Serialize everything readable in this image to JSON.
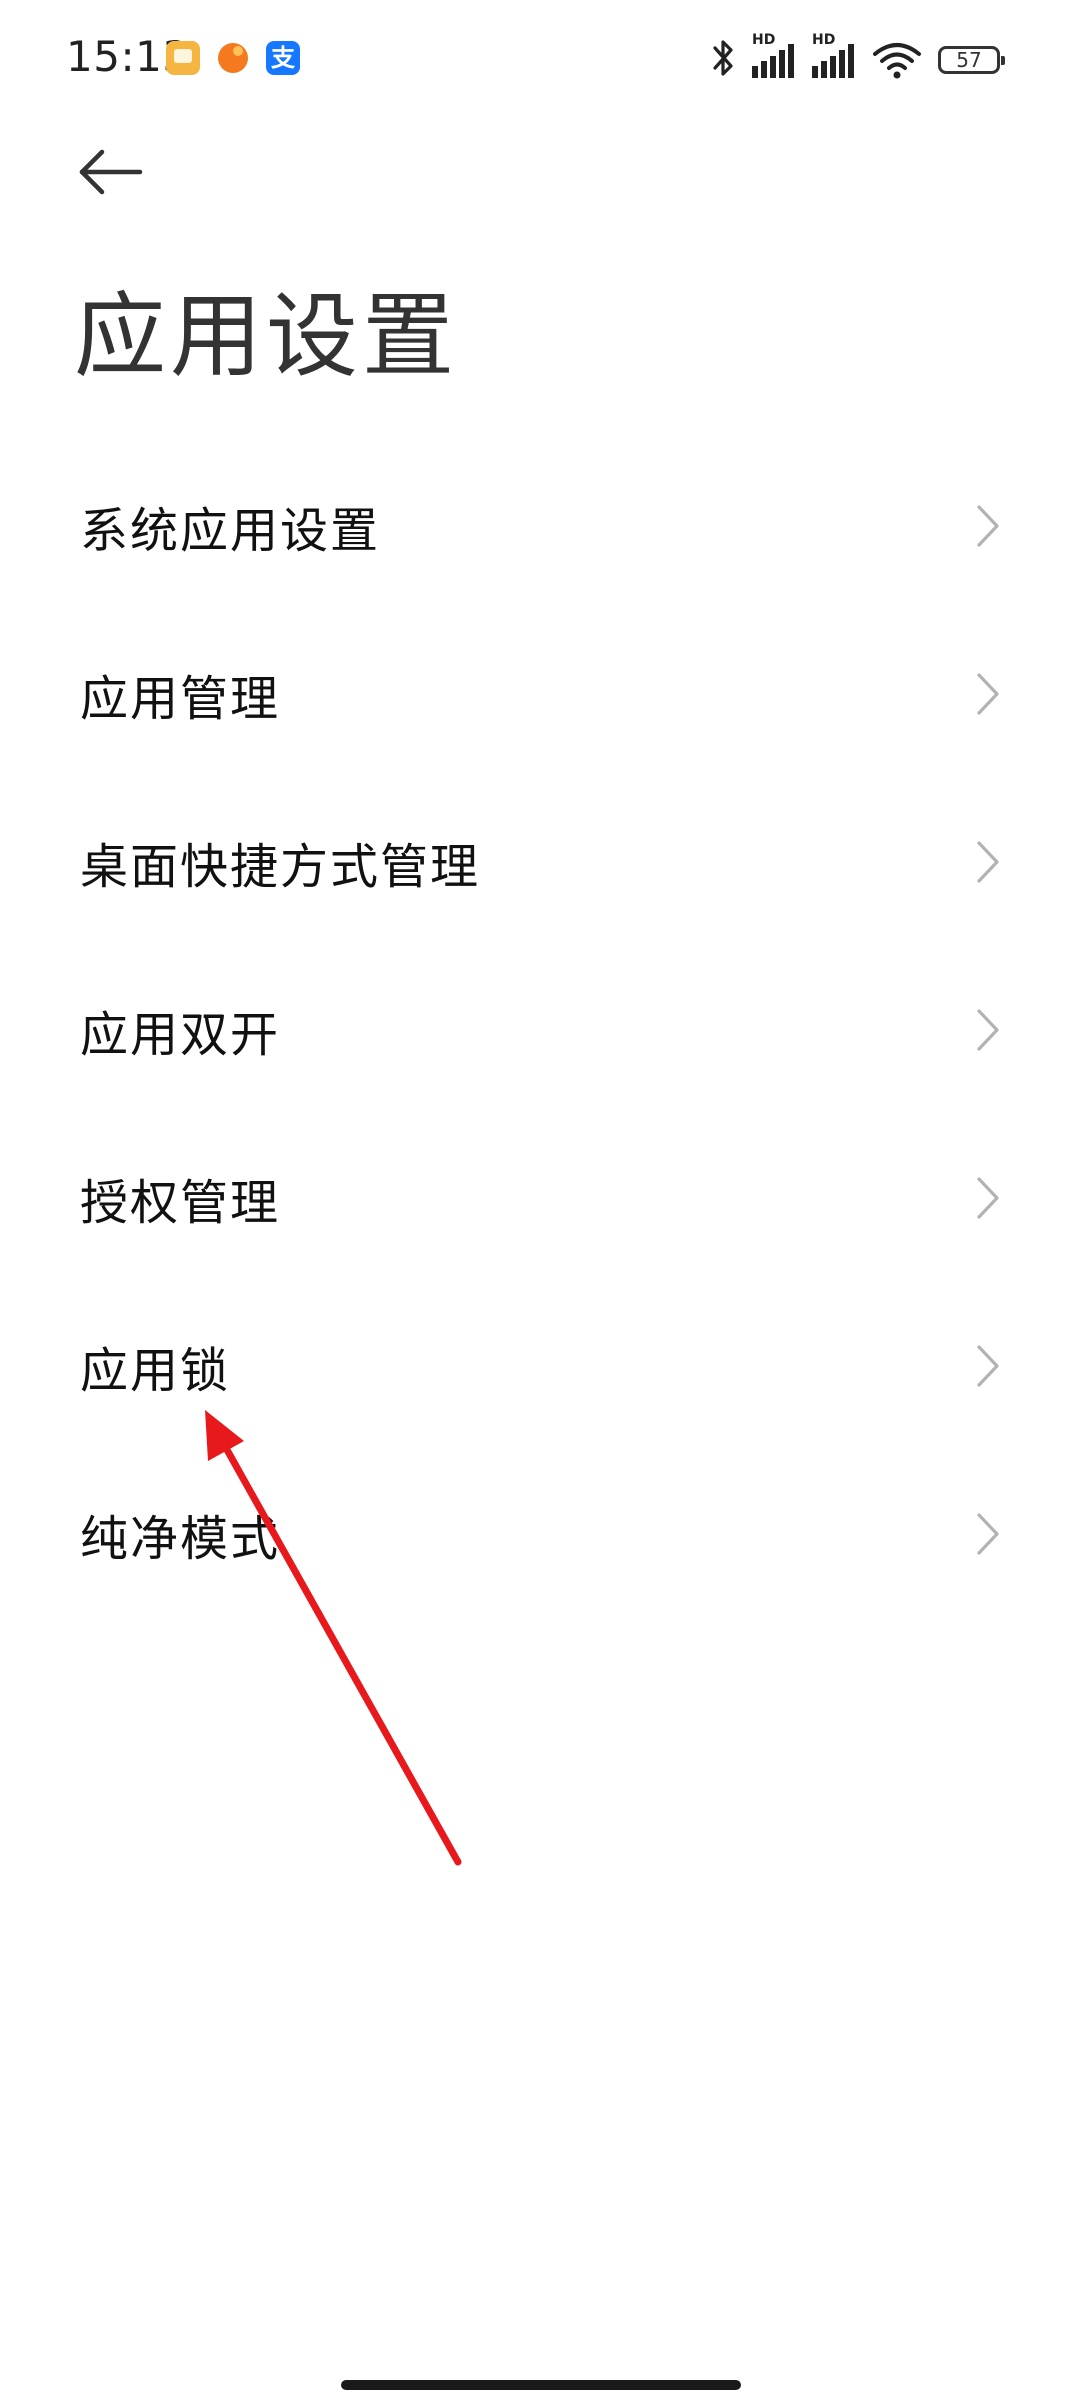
{
  "status_bar": {
    "time": "15:13",
    "notification_icons": [
      "notes-icon",
      "orange-app-icon",
      "alipay-icon"
    ],
    "alipay_glyph": "支",
    "hd_label_1": "HD",
    "hd_label_2": "HD",
    "battery_level": "57"
  },
  "header": {
    "back_icon": "arrow-left-icon",
    "title": "应用设置"
  },
  "settings": {
    "items": [
      {
        "label": "系统应用设置"
      },
      {
        "label": "应用管理"
      },
      {
        "label": "桌面快捷方式管理"
      },
      {
        "label": "应用双开"
      },
      {
        "label": "授权管理"
      },
      {
        "label": "应用锁"
      },
      {
        "label": "纯净模式"
      }
    ]
  },
  "colors": {
    "background": "#ffffff",
    "annotation_arrow": "#e8191c",
    "chevron": "#b3b3b3",
    "text_primary": "#111111",
    "title": "#333333"
  }
}
